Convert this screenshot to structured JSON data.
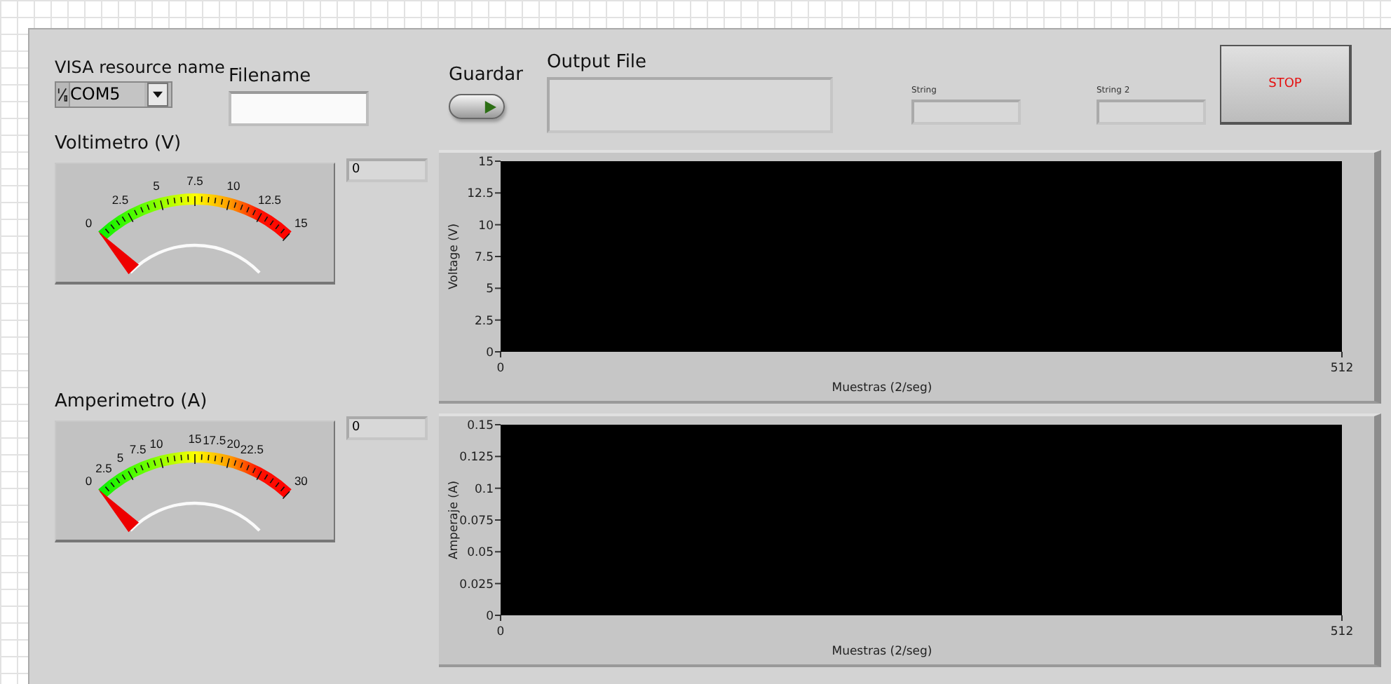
{
  "visa": {
    "label": "VISA resource name",
    "value": "COM5"
  },
  "filename": {
    "label": "Filename"
  },
  "save": {
    "label": "Guardar"
  },
  "output_file": {
    "label": "Output File"
  },
  "strings": [
    {
      "label": "String"
    },
    {
      "label": "String 2"
    }
  ],
  "stop_button": {
    "label": "STOP"
  },
  "gauges": [
    {
      "label": "Voltimetro (V)",
      "scale": [
        "0",
        "2.5",
        "5",
        "7.5",
        "10",
        "12.5",
        "15"
      ],
      "reading": "0"
    },
    {
      "label": "Amperimetro (A)",
      "scale": [
        "0",
        "2.5",
        "5",
        "7.5",
        "10",
        "15",
        "17.5",
        "20",
        "22.5",
        "30"
      ],
      "reading": "0"
    }
  ],
  "charts": [
    {
      "chart_data": {
        "type": "line",
        "xlabel": "Muestras (2/seg)",
        "ylabel": "Voltage (V)",
        "xlim": [
          0,
          512
        ],
        "ylim": [
          0,
          15
        ],
        "xticks": [
          {
            "value": 0,
            "label": "0"
          },
          512
        ],
        "yticks": [
          {
            "value": 0,
            "label": "0"
          },
          2.5,
          5,
          7.5,
          10,
          12.5,
          15
        ]
      }
    },
    {
      "chart_data": {
        "type": "line",
        "xlabel": "Muestras (2/seg)",
        "ylabel": "Amperaje (A)",
        "xlim": [
          0,
          512
        ],
        "ylim": [
          0,
          0.15
        ],
        "xticks": [
          {
            "value": 0,
            "label": "0"
          },
          512
        ],
        "yticks": [
          {
            "value": 0,
            "label": "0"
          },
          0.025,
          0.05,
          0.075,
          0.1,
          0.125,
          0.15
        ]
      }
    }
  ]
}
